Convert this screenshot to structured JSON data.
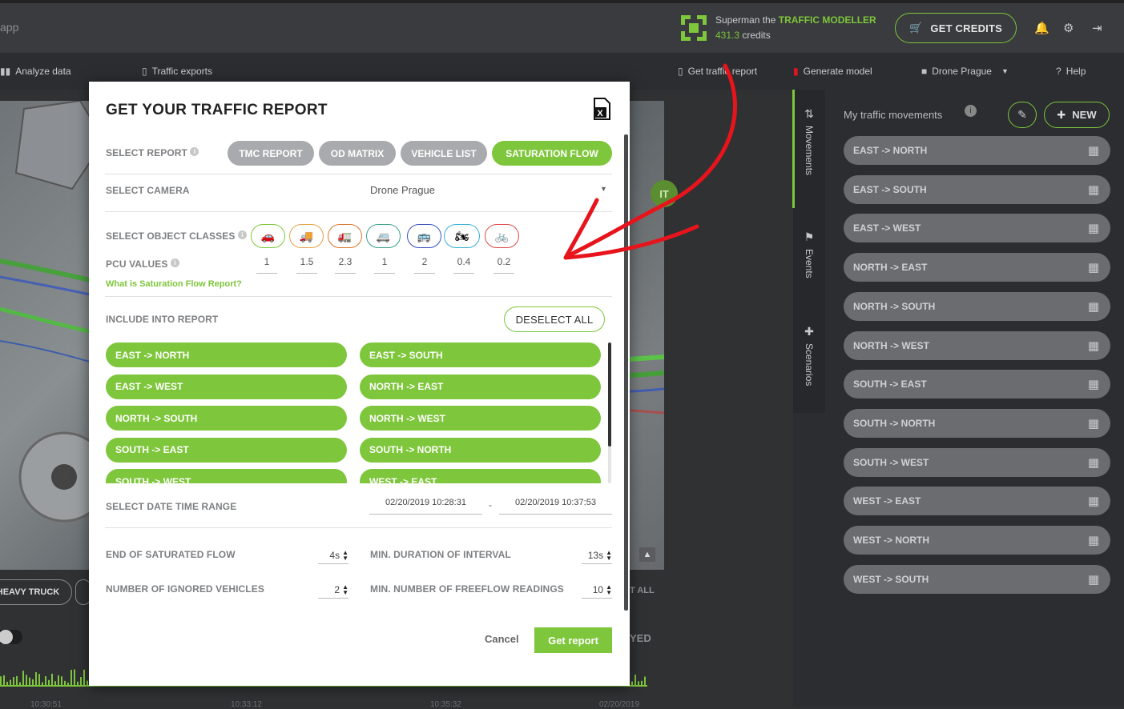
{
  "app": {
    "name": "app"
  },
  "user": {
    "name_prefix": "Superman the",
    "title": "TRAFFIC MODELLER",
    "credits_value": "431.3",
    "credits_label": "credits"
  },
  "header": {
    "get_credits": "GET CREDITS"
  },
  "nav": {
    "analyze": "Analyze data",
    "exports": "Traffic exports",
    "get_report": "Get traffic report",
    "generate_model": "Generate model",
    "camera": "Drone Prague",
    "help": "Help"
  },
  "side_tabs": [
    "Movements",
    "Events",
    "Scenarios"
  ],
  "movements_panel": {
    "title": "My traffic movements",
    "new_label": "NEW",
    "items": [
      "EAST -> NORTH",
      "EAST -> SOUTH",
      "EAST -> WEST",
      "NORTH -> EAST",
      "NORTH -> SOUTH",
      "NORTH -> WEST",
      "SOUTH -> EAST",
      "SOUTH -> NORTH",
      "SOUTH -> WEST",
      "WEST -> EAST",
      "WEST -> NORTH",
      "WEST -> SOUTH"
    ]
  },
  "background": {
    "class_chip": "HEAVY TRUCK",
    "select_all_fragment": "T ALL",
    "played_fragment": "YED",
    "timeline_ticks": [
      "10:30:51",
      "10:33:12",
      "10:35:32",
      "02/20/2019"
    ]
  },
  "modal": {
    "title": "GET YOUR TRAFFIC REPORT",
    "select_report_label": "SELECT REPORT",
    "report_types": [
      {
        "label": "TMC REPORT",
        "active": false
      },
      {
        "label": "OD MATRIX",
        "active": false
      },
      {
        "label": "VEHICLE LIST",
        "active": false
      },
      {
        "label": "SATURATION FLOW",
        "active": true
      }
    ],
    "select_camera_label": "SELECT CAMERA",
    "camera_value": "Drone Prague",
    "object_classes_label": "SELECT OBJECT CLASSES",
    "object_classes": [
      {
        "icon": "car-icon",
        "glyph": "🚗",
        "color": "#7ec63b"
      },
      {
        "icon": "truck-icon",
        "glyph": "🚚",
        "color": "#e5a24a"
      },
      {
        "icon": "heavy-truck-icon",
        "glyph": "🚛",
        "color": "#d9772e"
      },
      {
        "icon": "van-icon",
        "glyph": "🚐",
        "color": "#3aa38a"
      },
      {
        "icon": "bus-icon",
        "glyph": "🚌",
        "color": "#3a4fc0"
      },
      {
        "icon": "motorcycle-icon",
        "glyph": "🏍",
        "color": "#3ab0d8"
      },
      {
        "icon": "bicycle-icon",
        "glyph": "🚲",
        "color": "#e04a4a"
      }
    ],
    "pcu_label": "PCU VALUES",
    "pcu_values": [
      "1",
      "1.5",
      "2.3",
      "1",
      "2",
      "0.4",
      "0.2"
    ],
    "what_is_link": "What is Saturation Flow Report?",
    "include_label": "INCLUDE INTO REPORT",
    "deselect_all": "DESELECT ALL",
    "include_items": [
      "EAST -> NORTH",
      "EAST -> SOUTH",
      "EAST -> WEST",
      "NORTH -> EAST",
      "NORTH -> SOUTH",
      "NORTH -> WEST",
      "SOUTH -> EAST",
      "SOUTH -> NORTH",
      "SOUTH -> WEST",
      "WEST -> EAST"
    ],
    "date_range_label": "SELECT DATE TIME RANGE",
    "date_from": "02/20/2019 10:28:31",
    "date_sep": "-",
    "date_to": "02/20/2019 10:37:53",
    "end_sat_flow_label": "END OF SATURATED FLOW",
    "end_sat_flow_value": "4s",
    "min_duration_label": "MIN. DURATION OF INTERVAL",
    "min_duration_value": "13s",
    "ignored_label": "NUMBER OF IGNORED VEHICLES",
    "ignored_value": "2",
    "freeflow_label": "MIN. NUMBER OF FREEFLOW READINGS",
    "freeflow_value": "10",
    "cancel": "Cancel",
    "get_report": "Get report"
  },
  "colors": {
    "accent": "#7ec63b",
    "annotation": "#e8141c"
  }
}
